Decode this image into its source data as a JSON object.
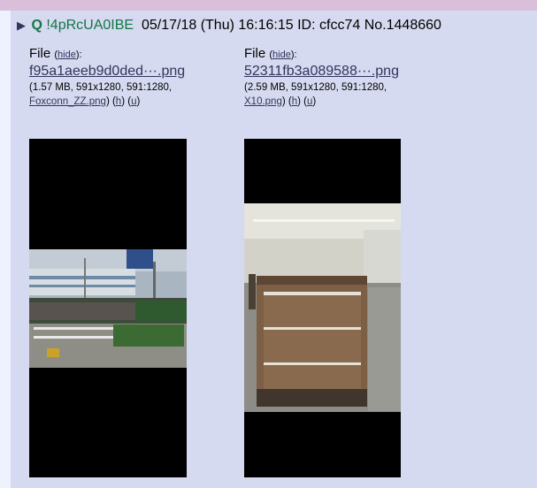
{
  "post": {
    "q_label": "Q",
    "tripcode": "!4pRcUA0IBE",
    "datetime": "05/17/18 (Thu) 16:16:15",
    "id_label": "ID:",
    "id_value": "cfcc74",
    "no_label": "No.",
    "post_number": "1448660"
  },
  "files": [
    {
      "file_label": "File",
      "hide_label": "hide",
      "filename": "f95a1aeeb9d0ded···.png",
      "meta_text": "(1.57 MB, 591x1280, 591:1280,",
      "original_name": "Foxconn_ZZ.png",
      "h_label": "h",
      "u_label": "u"
    },
    {
      "file_label": "File",
      "hide_label": "hide",
      "filename": "52311fb3a089588···.png",
      "meta_text": "(2.59 MB, 591x1280, 591:1280,",
      "original_name": "X10.png",
      "h_label": "h",
      "u_label": "u"
    }
  ],
  "colors": {
    "page_bg": "#eef2ff",
    "post_bg": "#d6daf0",
    "link": "#34345c",
    "name_green": "#117743",
    "top_band": "#d9bfd9"
  },
  "icons": {
    "expand": "triangle-right-icon"
  }
}
